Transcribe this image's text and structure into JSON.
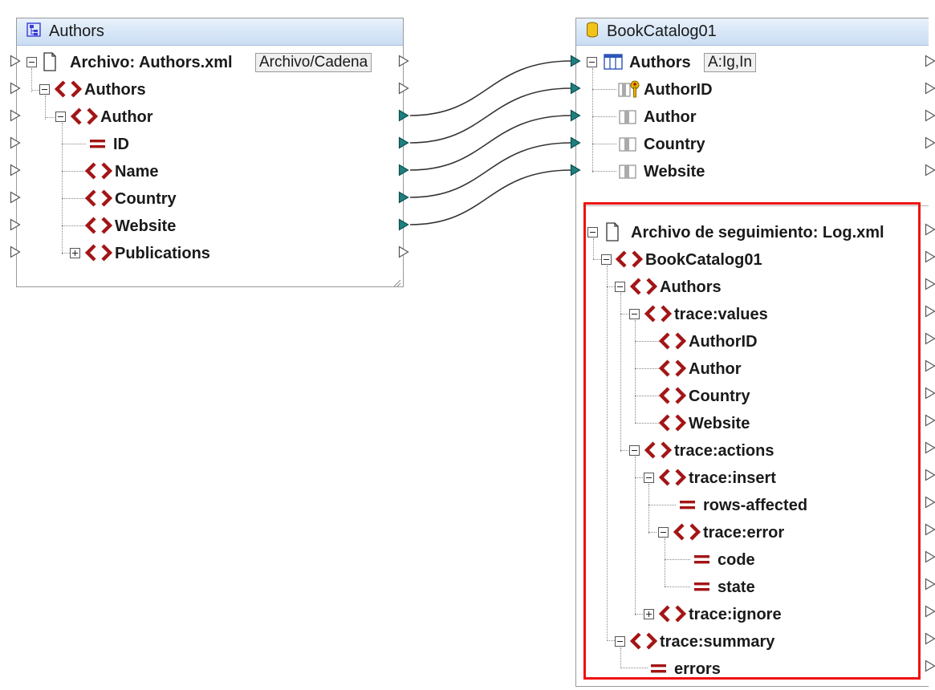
{
  "source": {
    "title": "Authors",
    "file_label": "Archivo: Authors.xml",
    "file_button": "Archivo/Cadena",
    "items": [
      "Authors",
      "Author",
      "ID",
      "Name",
      "Country",
      "Website",
      "Publications"
    ]
  },
  "target": {
    "title": "BookCatalog01",
    "table_label": "Authors",
    "table_button": "A:Ig,In",
    "columns": [
      "AuthorID",
      "Author",
      "Country",
      "Website"
    ],
    "trace_file_label": "Archivo de seguimiento: Log.xml",
    "trace": {
      "root": "BookCatalog01",
      "authors": "Authors",
      "values": "trace:values",
      "value_items": [
        "AuthorID",
        "Author",
        "Country",
        "Website"
      ],
      "actions": "trace:actions",
      "insert": "trace:insert",
      "rows_affected": "rows-affected",
      "error": "trace:error",
      "code": "code",
      "state": "state",
      "ignore": "trace:ignore",
      "summary": "trace:summary",
      "errors": "errors"
    }
  },
  "colors": {
    "element_icon": "#a31515",
    "connector": "#333333",
    "port_filled": "#1f7f7f",
    "highlight": "#ee1111"
  }
}
